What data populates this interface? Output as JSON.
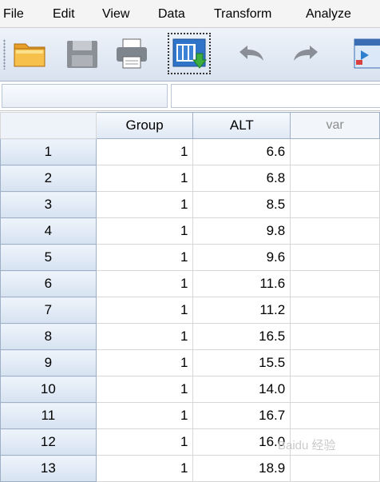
{
  "menu": [
    {
      "name": "menu-file",
      "label": "File"
    },
    {
      "name": "menu-edit",
      "label": "Edit"
    },
    {
      "name": "menu-view",
      "label": "View"
    },
    {
      "name": "menu-data",
      "label": "Data"
    },
    {
      "name": "menu-transform",
      "label": "Transform"
    },
    {
      "name": "menu-analyze",
      "label": "Analyze"
    }
  ],
  "toolbar": {
    "icons": [
      "open-folder-icon",
      "save-icon",
      "print-icon",
      "dialog-recall-icon",
      "undo-icon",
      "redo-icon",
      "goto-case-icon"
    ]
  },
  "editor": {
    "cell_name": "",
    "cell_value": ""
  },
  "columns": [
    "Group",
    "ALT",
    "var"
  ],
  "rows": [
    {
      "n": "1",
      "group": "1",
      "alt": "6.6"
    },
    {
      "n": "2",
      "group": "1",
      "alt": "6.8"
    },
    {
      "n": "3",
      "group": "1",
      "alt": "8.5"
    },
    {
      "n": "4",
      "group": "1",
      "alt": "9.8"
    },
    {
      "n": "5",
      "group": "1",
      "alt": "9.6"
    },
    {
      "n": "6",
      "group": "1",
      "alt": "11.6"
    },
    {
      "n": "7",
      "group": "1",
      "alt": "11.2"
    },
    {
      "n": "8",
      "group": "1",
      "alt": "16.5"
    },
    {
      "n": "9",
      "group": "1",
      "alt": "15.5"
    },
    {
      "n": "10",
      "group": "1",
      "alt": "14.0"
    },
    {
      "n": "11",
      "group": "1",
      "alt": "16.7"
    },
    {
      "n": "12",
      "group": "1",
      "alt": "16.0"
    },
    {
      "n": "13",
      "group": "1",
      "alt": "18.9"
    }
  ],
  "watermark": "Baidu 经验"
}
